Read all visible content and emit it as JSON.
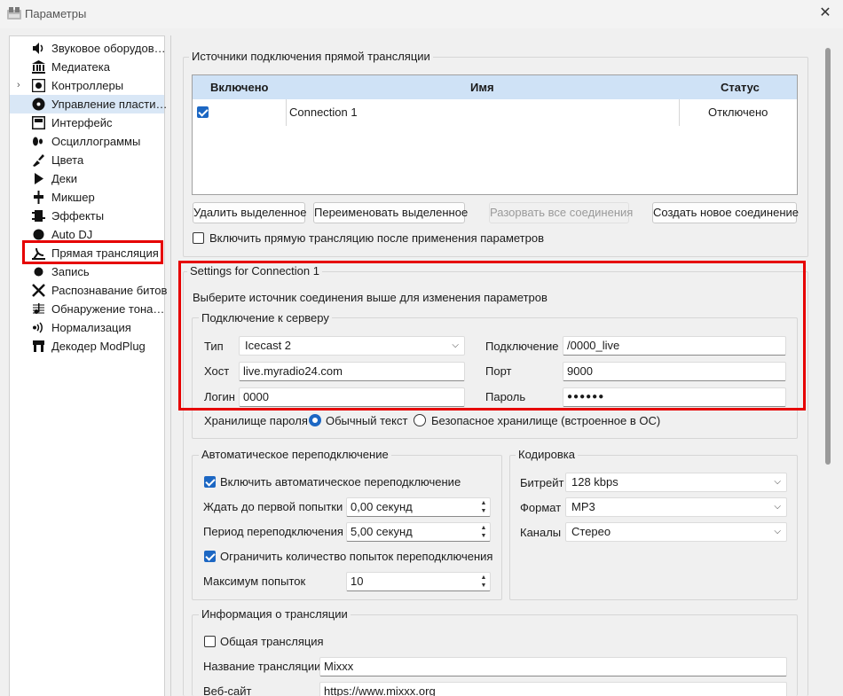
{
  "window": {
    "title": "Параметры",
    "close_glyph": "✕"
  },
  "sidebar": {
    "items": [
      {
        "label": "Звуковое оборудов…",
        "icon": "speaker-icon"
      },
      {
        "label": "Медиатека",
        "icon": "library-icon"
      },
      {
        "label": "Контроллеры",
        "icon": "controller-icon",
        "expander": "›"
      },
      {
        "label": "Управление пласти…",
        "icon": "vinyl-icon"
      },
      {
        "label": "Интерфейс",
        "icon": "interface-icon"
      },
      {
        "label": "Осциллограммы",
        "icon": "waveform-icon"
      },
      {
        "label": "Цвета",
        "icon": "palette-icon"
      },
      {
        "label": "Деки",
        "icon": "play-icon"
      },
      {
        "label": "Микшер",
        "icon": "mixer-icon"
      },
      {
        "label": "Эффекты",
        "icon": "effects-icon"
      },
      {
        "label": "Auto DJ",
        "icon": "autodj-icon"
      },
      {
        "label": "Прямая трансляция",
        "icon": "broadcast-icon"
      },
      {
        "label": "Запись",
        "icon": "record-icon"
      },
      {
        "label": "Распознавание битов",
        "icon": "beats-icon"
      },
      {
        "label": "Обнаружение тона…",
        "icon": "key-icon"
      },
      {
        "label": "Нормализация",
        "icon": "normalize-icon"
      },
      {
        "label": "Декодер ModPlug",
        "icon": "modplug-icon"
      }
    ]
  },
  "sources": {
    "group_title": "Источники подключения прямой трансляции",
    "columns": [
      "Включено",
      "Имя",
      "Статус"
    ],
    "rows": [
      {
        "enabled": true,
        "name": "Connection 1",
        "status": "Отключено"
      }
    ],
    "buttons": {
      "delete": "Удалить выделенное",
      "rename": "Переименовать выделенное",
      "disconnect_all": "Разорвать все соединения",
      "create": "Создать новое соединение"
    },
    "enable_after_apply": "Включить прямую трансляцию после применения параметров"
  },
  "settings": {
    "group_title": "Settings for Connection 1",
    "hint": "Выберите источник соединения выше для изменения параметров",
    "server": {
      "group_title": "Подключение к серверу",
      "type_label": "Тип",
      "type_value": "Icecast 2",
      "host_label": "Хост",
      "host_value": "live.myradio24.com",
      "login_label": "Логин",
      "login_value": "0000",
      "mount_label": "Подключение",
      "mount_value": "/0000_live",
      "port_label": "Порт",
      "port_value": "9000",
      "password_label": "Пароль",
      "password_value": "●●●●●●",
      "storage_label": "Хранилище пароля",
      "storage_plain": "Обычный текст",
      "storage_secure": "Безопасное хранилище (встроенное в ОС)"
    },
    "reconnect": {
      "group_title": "Автоматическое переподключение",
      "enable": "Включить автоматическое переподключение",
      "first_wait_label": "Ждать до первой попытки",
      "first_wait_value": "0,00 секунд",
      "period_label": "Период переподключения",
      "period_value": "5,00 секунд",
      "limit": "Ограничить количество попыток переподключения",
      "max_label": "Максимум попыток",
      "max_value": "10"
    },
    "encoding": {
      "group_title": "Кодировка",
      "bitrate_label": "Битрейт",
      "bitrate_value": "128 kbps",
      "format_label": "Формат",
      "format_value": "MP3",
      "channels_label": "Каналы",
      "channels_value": "Стерео"
    },
    "info": {
      "group_title": "Информация о трансляции",
      "public": "Общая трансляция",
      "name_label": "Название трансляции",
      "name_value": "Mixxx",
      "website_label": "Веб-сайт",
      "website_value": "https://www.mixxx.org"
    }
  },
  "colors": {
    "highlight": "#e60000",
    "accent": "#1c67c3",
    "header_bg": "#cfe2f6"
  }
}
